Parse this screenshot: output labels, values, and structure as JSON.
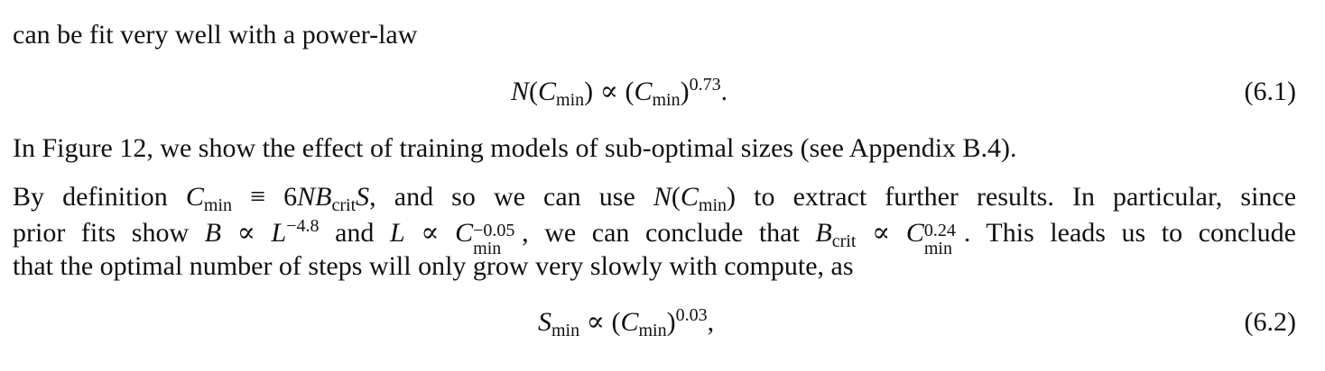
{
  "paragraph_top": {
    "line1": "can be fit very well with a power-law"
  },
  "equation_1": {
    "lhs_N": "N",
    "open_paren": "(",
    "C": "C",
    "min": "min",
    "close_paren": ")",
    "propto": " ∝ ",
    "rhs_open": "(",
    "rhs_C": "C",
    "rhs_min": "min",
    "rhs_close": ")",
    "exponent": "0.73",
    "period": ".",
    "number": "(6.1)"
  },
  "paragraph_figure": {
    "text": "In Figure 12, we show the effect of training models of sub-optimal sizes (see Appendix B.4)."
  },
  "paragraph_definition": {
    "line1_a": "By definition ",
    "line1_C": "C",
    "line1_min": "min",
    "line1_equiv": " ≡ 6",
    "line1_NB": "NB",
    "line1_crit": "crit",
    "line1_S": "S",
    "line1_b": ", and so we can use ",
    "line1_N": "N",
    "line1_paren_open": "(",
    "line1_C2": "C",
    "line1_min2": "min",
    "line1_paren_close": ")",
    "line1_c": " to extract further results. In particular, since",
    "line2_a": "prior fits show ",
    "line2_B": "B",
    "line2_propto1": " ∝ ",
    "line2_L": "L",
    "line2_L_exp": "−4.8",
    "line2_b": " and ",
    "line2_L2": "L",
    "line2_propto2": " ∝ ",
    "line2_C": "C",
    "line2_C_exp": "−0.05",
    "line2_C_sub": "min",
    "line2_c": ", we can conclude that ",
    "line2_B2": "B",
    "line2_crit": "crit",
    "line2_propto3": " ∝ ",
    "line2_C2": "C",
    "line2_C2_exp": "0.24",
    "line2_C2_sub": "min",
    "line2_d": ". This leads us to conclude",
    "line3": "that the optimal number of steps will only grow very slowly with compute, as"
  },
  "equation_2": {
    "S": "S",
    "min": "min",
    "propto": " ∝ ",
    "open": "(",
    "C": "C",
    "cmin": "min",
    "close": ")",
    "exponent": "0.03",
    "comma": ",",
    "number": "(6.2)"
  }
}
